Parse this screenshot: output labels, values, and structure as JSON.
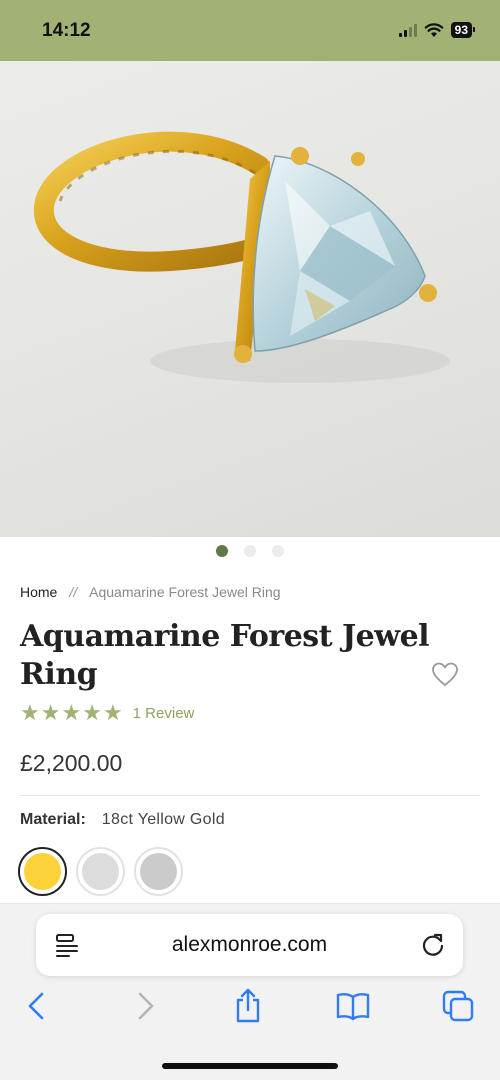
{
  "status_bar": {
    "time": "14:12",
    "battery": "93"
  },
  "product": {
    "image_alt": "Aquamarine ring in textured yellow gold",
    "carousel": {
      "count": 3,
      "active_index": 0
    },
    "breadcrumb": {
      "home": "Home",
      "separator": "//",
      "current": "Aquamarine Forest Jewel Ring"
    },
    "title": "Aquamarine Forest Jewel Ring",
    "rating": {
      "stars": 5,
      "review_label": "1 Review"
    },
    "price": "£2,200.00",
    "material": {
      "label": "Material:",
      "value": "18ct Yellow Gold",
      "swatches": [
        {
          "name": "Yellow Gold",
          "color": "#fcd23a",
          "selected": true
        },
        {
          "name": "Silver",
          "color": "#dcdcdc",
          "selected": false
        },
        {
          "name": "White Gold",
          "color": "#cbcbcb",
          "selected": false
        }
      ]
    }
  },
  "browser": {
    "url": "alexmonroe.com",
    "toolbar": [
      "back",
      "forward",
      "share",
      "bookmarks",
      "tabs"
    ]
  },
  "colors": {
    "brand_green": "#a2b274",
    "star_green": "#a2b274",
    "active_dot": "#5d7a47",
    "ios_blue": "#2f7cf6"
  }
}
